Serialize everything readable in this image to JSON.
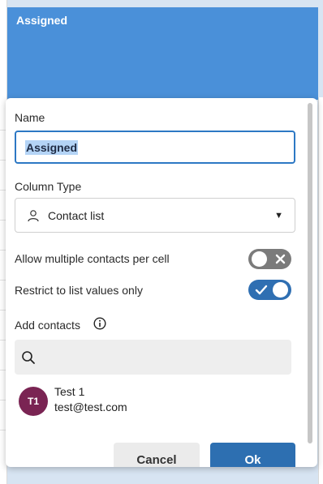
{
  "header": {
    "title": "Assigned"
  },
  "form": {
    "name_label": "Name",
    "name_value": "Assigned",
    "column_type_label": "Column Type",
    "column_type_value": "Contact list",
    "allow_multiple_label": "Allow multiple contacts per cell",
    "allow_multiple_on": false,
    "restrict_label": "Restrict to list values only",
    "restrict_on": true,
    "add_contacts_label": "Add contacts",
    "search_value": ""
  },
  "contacts": [
    {
      "initials": "T1",
      "name": "Test 1",
      "email": "test@test.com",
      "avatar_color": "#7a2453"
    }
  ],
  "buttons": {
    "cancel": "Cancel",
    "ok": "Ok"
  },
  "colors": {
    "accent": "#2d6fb1",
    "header": "#4a90d9"
  }
}
